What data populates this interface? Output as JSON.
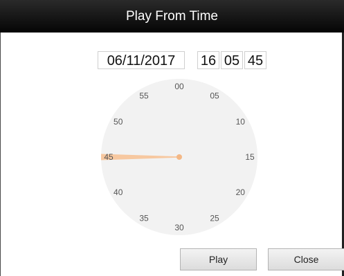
{
  "dialog": {
    "title": "Play From Time"
  },
  "time": {
    "date": "06/11/2017",
    "hours": "16",
    "minutes": "05",
    "seconds": "45"
  },
  "clock": {
    "labels": [
      "00",
      "05",
      "10",
      "15",
      "20",
      "25",
      "30",
      "35",
      "40",
      "45",
      "50",
      "55"
    ],
    "selected_second": 45,
    "face_color": "#f2f2f2",
    "hand_color": "#f7c8a0",
    "hub_color": "#f4b886"
  },
  "buttons": {
    "play_label": "Play",
    "close_label": "Close"
  }
}
